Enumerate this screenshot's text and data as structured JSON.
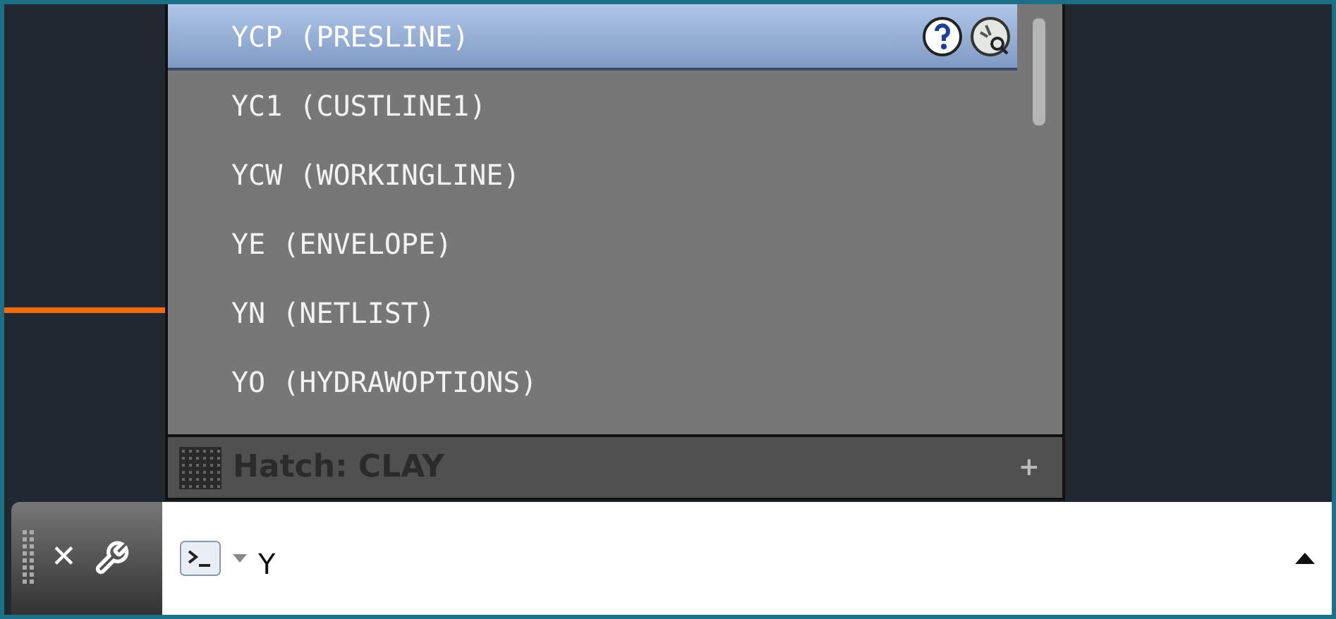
{
  "suggestions": [
    {
      "label": "YCP (PRESLINE)",
      "selected": true
    },
    {
      "label": "YC1 (CUSTLINE1)",
      "selected": false
    },
    {
      "label": "YCW (WORKINGLINE)",
      "selected": false
    },
    {
      "label": "YE (ENVELOPE)",
      "selected": false
    },
    {
      "label": "YN (NETLIST)",
      "selected": false
    },
    {
      "label": "YO (HYDRAWOPTIONS)",
      "selected": false
    }
  ],
  "hatch_bar": {
    "label": "Hatch: CLAY",
    "action": "+"
  },
  "command_line": {
    "close": "✕",
    "value": "Y"
  }
}
